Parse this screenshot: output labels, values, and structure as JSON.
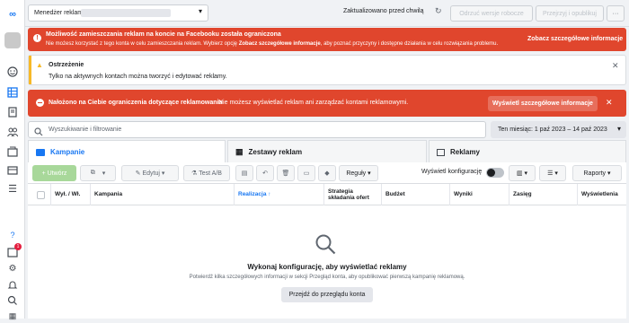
{
  "app": {
    "manager_label": "Menedżer reklam"
  },
  "topbar": {
    "status": "Zaktualizowano przed chwilą",
    "discard_label": "Odrzuć wersje robocze",
    "review_label": "Przejrzyj i opublikuj",
    "more_label": "···"
  },
  "limit_banner": {
    "title": "Możliwość zamieszczania reklam na koncie na Facebooku została ograniczona",
    "body": "Nie możesz korzystać z tego konta w celu zamieszczania reklam. Wybierz opcję ",
    "body_bold": "Zobacz szczegółowe informacje",
    "body_rest": ", aby poznać przyczyny i dostępne działania w celu rozwiązania problemu.",
    "link": "Zobacz szczegółowe informacje"
  },
  "warning_banner": {
    "title": "Ostrzeżenie",
    "body": "Tylko na aktywnych kontach można tworzyć i edytować reklamy."
  },
  "restriction_banner": {
    "title": "Nałożono na Ciebie ograniczenia dotyczące reklamowania",
    "body": "Nie możesz wyświetlać reklam ani zarządzać kontami reklamowymi.",
    "button": "Wyświetl szczegółowe informacje"
  },
  "search": {
    "placeholder": "Wyszukiwanie i filtrowanie",
    "date_range": "Ten miesiąc: 1 paź 2023 – 14 paź 2023"
  },
  "tabs": [
    {
      "label": "Kampanie"
    },
    {
      "label": "Zestawy reklam"
    },
    {
      "label": "Reklamy"
    }
  ],
  "toolbar": {
    "create": "+ Utwórz",
    "edit": "Edytuj",
    "ab_test": "Test A/B",
    "rules": "Reguły",
    "show_config": "Wyświetl konfigurację",
    "reports": "Raporty"
  },
  "columns": [
    {
      "label": "Wył. / Wł."
    },
    {
      "label": "Kampania"
    },
    {
      "label": "Realizacja ↑"
    },
    {
      "label": "Strategia składania ofert"
    },
    {
      "label": "Budżet"
    },
    {
      "label": "Wyniki"
    },
    {
      "label": "Zasięg"
    },
    {
      "label": "Wyświetlenia"
    }
  ],
  "empty": {
    "title": "Wykonaj konfigurację, aby wyświetlać reklamy",
    "body": "Potwierdź kilka szczegółowych informacji w sekcji Przegląd konta, aby opublikować pierwszą kampanię reklamową.",
    "button": "Przejdź do przeglądu konta"
  },
  "rail": {
    "badge": "1"
  },
  "colors": {
    "red": "#e0462d",
    "blue": "#1877f2",
    "green": "#42b72a"
  }
}
